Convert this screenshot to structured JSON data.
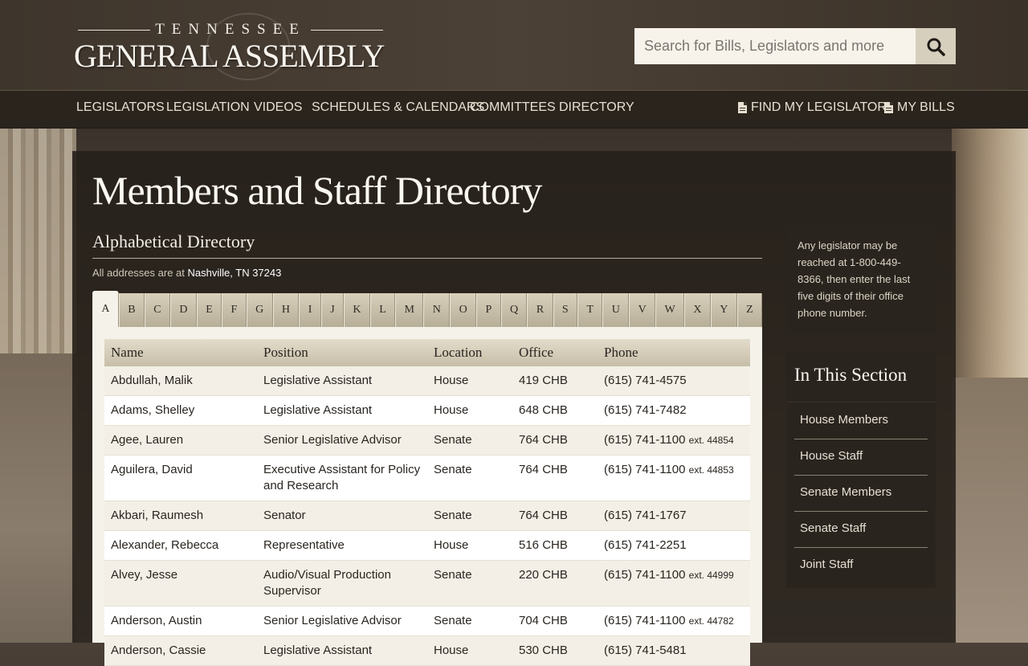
{
  "brand": {
    "top": "TENNESSEE",
    "main": "GENERAL ASSEMBLY"
  },
  "search": {
    "placeholder": "Search for Bills, Legislators and more"
  },
  "nav": {
    "items": [
      "LEGISLATORS",
      "LEGISLATION",
      "VIDEOS",
      "SCHEDULES & CALENDARS",
      "COMMITTEES",
      "DIRECTORY"
    ],
    "right": [
      "FIND MY LEGISLATOR",
      "MY BILLS"
    ]
  },
  "page": {
    "title": "Members and Staff Directory",
    "subtitle": "Alphabetical Directory",
    "address_prefix": "All addresses are at ",
    "address": "Nashville, TN 37243"
  },
  "letters": [
    "A",
    "B",
    "C",
    "D",
    "E",
    "F",
    "G",
    "H",
    "I",
    "J",
    "K",
    "L",
    "M",
    "N",
    "O",
    "P",
    "Q",
    "R",
    "S",
    "T",
    "U",
    "V",
    "W",
    "X",
    "Y",
    "Z"
  ],
  "active_letter": "A",
  "table": {
    "headers": [
      "Name",
      "Position",
      "Location",
      "Office",
      "Phone"
    ],
    "rows": [
      {
        "name": "Abdullah, Malik",
        "position": "Legislative Assistant",
        "location": "House",
        "office": "419 CHB",
        "phone": "(615) 741-4575",
        "ext": ""
      },
      {
        "name": "Adams, Shelley",
        "position": "Legislative Assistant",
        "location": "House",
        "office": "648 CHB",
        "phone": "(615) 741-7482",
        "ext": ""
      },
      {
        "name": "Agee, Lauren",
        "position": "Senior Legislative Advisor",
        "location": "Senate",
        "office": "764 CHB",
        "phone": "(615) 741-1100",
        "ext": "ext. 44854"
      },
      {
        "name": "Aguilera, David",
        "position": "Executive Assistant for Policy and Research",
        "location": "Senate",
        "office": "764 CHB",
        "phone": "(615) 741-1100",
        "ext": "ext. 44853"
      },
      {
        "name": "Akbari, Raumesh",
        "position": "Senator",
        "location": "Senate",
        "office": "764 CHB",
        "phone": "(615) 741-1767",
        "ext": ""
      },
      {
        "name": "Alexander, Rebecca",
        "position": "Representative",
        "location": "House",
        "office": "516 CHB",
        "phone": "(615) 741-2251",
        "ext": ""
      },
      {
        "name": "Alvey, Jesse",
        "position": "Audio/Visual Production Supervisor",
        "location": "Senate",
        "office": "220 CHB",
        "phone": "(615) 741-1100",
        "ext": "ext. 44999"
      },
      {
        "name": "Anderson, Austin",
        "position": "Senior Legislative Advisor",
        "location": "Senate",
        "office": "704 CHB",
        "phone": "(615) 741-1100",
        "ext": "ext. 44782"
      },
      {
        "name": "Anderson, Cassie",
        "position": "Legislative Assistant",
        "location": "House",
        "office": "530 CHB",
        "phone": "(615) 741-5481",
        "ext": ""
      }
    ]
  },
  "sidebar": {
    "note": "Any legislator may be reached at 1-800-449-8366, then enter the last five digits of their office phone number.",
    "section_title": "In This Section",
    "links": [
      "House Members",
      "House Staff",
      "Senate Members",
      "Senate Staff",
      "Joint Staff"
    ]
  }
}
